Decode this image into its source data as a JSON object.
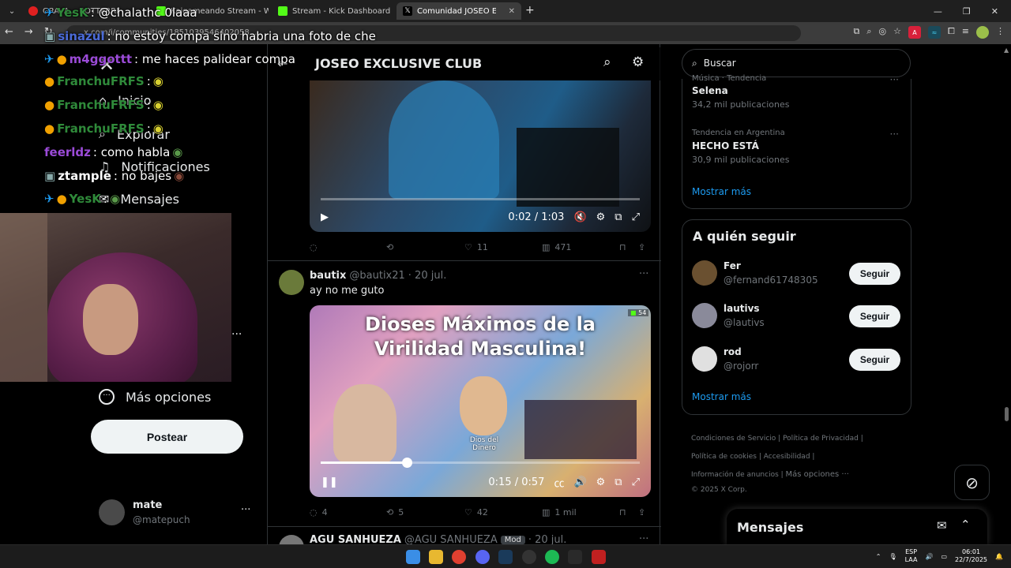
{
  "browser": {
    "tabs": [
      {
        "label": "GRAVA... ROTTERRI",
        "active": false
      },
      {
        "label": "Kaigameando Stream - Watch Live",
        "active": false
      },
      {
        "label": "Stream - Kick Dashboard",
        "active": false
      },
      {
        "label": "Comunidad JOSEO EXCLUSIVE",
        "active": true
      }
    ],
    "new_tab": "+",
    "url": "x.com/i/communities/1851039546402058..."
  },
  "community": {
    "title": "JOSEO EXCLUSIVE CLUB"
  },
  "left_nav": {
    "items": [
      "Inicio",
      "Explorar",
      "Notificaciones",
      "Mensajes"
    ],
    "more": "Más opciones",
    "post_button": "Postear",
    "user": {
      "name": "mate",
      "handle": "@matepuch",
      "more": "···"
    }
  },
  "posts": [
    {
      "video": {
        "time": "0:02 / 1:03",
        "state": "paused"
      },
      "stats": {
        "reply": "",
        "repost": "",
        "like": "11",
        "views": "471"
      }
    },
    {
      "author": "bautix",
      "handle": "@bautix21",
      "date": "· 20 jul.",
      "more": "···",
      "text": "ay no me guto",
      "video": {
        "caption_line1": "Dioses Máximos de la",
        "caption_line2": "Virilidad Masculina!",
        "label": "Dios del Dinero",
        "viewer_badge": "54",
        "time": "0:15 / 0:57",
        "progress": 0.27,
        "state": "playing"
      },
      "stats": {
        "reply": "4",
        "repost": "5",
        "like": "42",
        "views": "1 mil"
      }
    },
    {
      "author": "AGU SANHUEZA",
      "handle": "@AGU SANHUEZA",
      "badge": "Mod",
      "date": "· 20 jul.",
      "more": "···"
    }
  ],
  "search": {
    "placeholder": "Buscar"
  },
  "trends": [
    {
      "context": "Música · Tendencia",
      "name": "Selena",
      "count": "34,2 mil publicaciones"
    },
    {
      "context": "Tendencia en Argentina",
      "name": "HECHO ESTÁ",
      "count": "30,9 mil publicaciones"
    }
  ],
  "trends_more": "Mostrar más",
  "who_to_follow": {
    "title": "A quién seguir",
    "users": [
      {
        "name": "Fer",
        "handle": "@fernand61748305",
        "button": "Seguir"
      },
      {
        "name": "lautivs",
        "handle": "@lautivs",
        "button": "Seguir"
      },
      {
        "name": "rod",
        "handle": "@rojorr",
        "button": "Seguir"
      }
    ],
    "more": "Mostrar más"
  },
  "footer": {
    "links": [
      "Condiciones de Servicio",
      "Política de Privacidad",
      "Política de cookies",
      "Accesibilidad",
      "Información de anuncios",
      "Más opciones ···"
    ],
    "copyright": "© 2025 X Corp."
  },
  "messages_drawer": {
    "title": "Mensajes"
  },
  "chat_overlay": [
    {
      "user": "YesK",
      "msg": ": @chalathc 0laaa",
      "color": "#ffffff"
    },
    {
      "user": "sinazul",
      "msg": ": no estoy compa sino habria una foto de che",
      "color": "#4b6bd8"
    },
    {
      "user": "m4ggottt",
      "msg": ": me haces palidear compa",
      "color": "#9b4bd8"
    },
    {
      "user": "FranchuFRFS",
      "msg": ":",
      "color": "#2f8a3a"
    },
    {
      "user": "FranchuFRFS",
      "msg": ":",
      "color": "#2f8a3a"
    },
    {
      "user": "FranchuFRFS",
      "msg": ":",
      "color": "#2f8a3a"
    },
    {
      "user": "feerldz",
      "msg": ": como habla",
      "color": "#9b4bd8"
    },
    {
      "user": "ztample",
      "msg": ": no bajes",
      "color": "#ffffff"
    },
    {
      "user": "YesK",
      "msg": ":",
      "color": "#2f8a3a"
    }
  ],
  "taskbar": {
    "lang1": "ESP",
    "lang2": "LAA",
    "time": "06:01",
    "date": "22/7/2025"
  },
  "colors": {
    "accent": "#1d9bf0",
    "bg": "#000000",
    "border": "#2f3336",
    "muted": "#71767b"
  }
}
